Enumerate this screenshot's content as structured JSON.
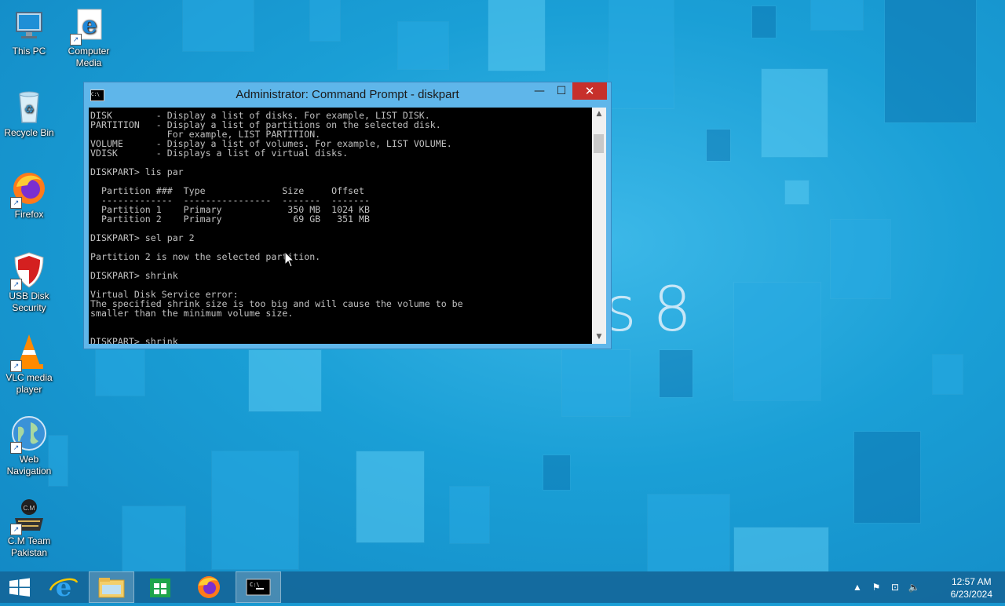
{
  "desktop": {
    "watermark": "s 8",
    "icons": [
      {
        "label": "This PC"
      },
      {
        "label": "Computer Media"
      },
      {
        "label": "Recycle Bin"
      },
      {
        "label": "Firefox"
      },
      {
        "label": "USB Disk Security"
      },
      {
        "label": "VLC media player"
      },
      {
        "label": "Web Navigation"
      },
      {
        "label": "C.M Team Pakistan"
      }
    ]
  },
  "cmd": {
    "title": "Administrator: Command Prompt - diskpart",
    "icon_text": "C:\\",
    "minimize": "—",
    "maximize": "☐",
    "close": "✕",
    "lines": "DISK        - Display a list of disks. For example, LIST DISK.\nPARTITION   - Display a list of partitions on the selected disk.\n              For example, LIST PARTITION.\nVOLUME      - Display a list of volumes. For example, LIST VOLUME.\nVDISK       - Displays a list of virtual disks.\n\nDISKPART> lis par\n\n  Partition ###  Type              Size     Offset\n  -------------  ----------------  -------  -------\n  Partition 1    Primary            350 MB  1024 KB\n  Partition 2    Primary             69 GB   351 MB\n\nDISKPART> sel par 2\n\nPartition 2 is now the selected partition.\n\nDISKPART> shrink\n\nVirtual Disk Service error:\nThe specified shrink size is too big and will cause the volume to be\nsmaller than the minimum volume size.\n\n\nDISKPART> shrink"
  },
  "taskbar": {
    "items": [
      "start-button",
      "internet-explorer",
      "file-explorer",
      "store",
      "firefox",
      "command-prompt"
    ],
    "clock_time": "12:57 AM",
    "clock_date": "6/23/2024"
  },
  "colors": {
    "accent": "#1a9fd6",
    "close": "#c7302b"
  }
}
